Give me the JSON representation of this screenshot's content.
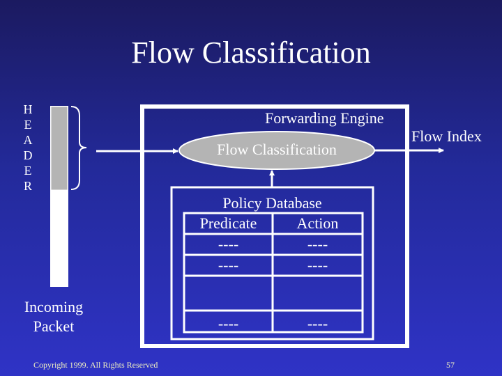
{
  "slide": {
    "title": "Flow Classification",
    "footer": {
      "copyright": "Copyright 1999. All Rights Reserved",
      "slide_number": "57"
    }
  },
  "packet": {
    "header_letters": [
      "H",
      "E",
      "A",
      "D",
      "E",
      "R"
    ],
    "label_line1": "Incoming",
    "label_line2": "Packet",
    "header_fill_color": "#b4b4b4"
  },
  "forwarding_engine": {
    "label": "Forwarding Engine",
    "classifier": {
      "label": "Flow Classification",
      "fill_color": "#b4b4b4"
    },
    "output_label": "Flow Index",
    "policy_database": {
      "title": "Policy Database",
      "columns": [
        "Predicate",
        "Action"
      ],
      "rows": [
        [
          "----",
          "----"
        ],
        [
          "----",
          "----"
        ],
        [
          "",
          ""
        ],
        [
          "----",
          "----"
        ]
      ]
    }
  },
  "colors": {
    "background_top": "#1b1a60",
    "background_bottom": "#2f33c6",
    "line_color": "#ffffff"
  }
}
